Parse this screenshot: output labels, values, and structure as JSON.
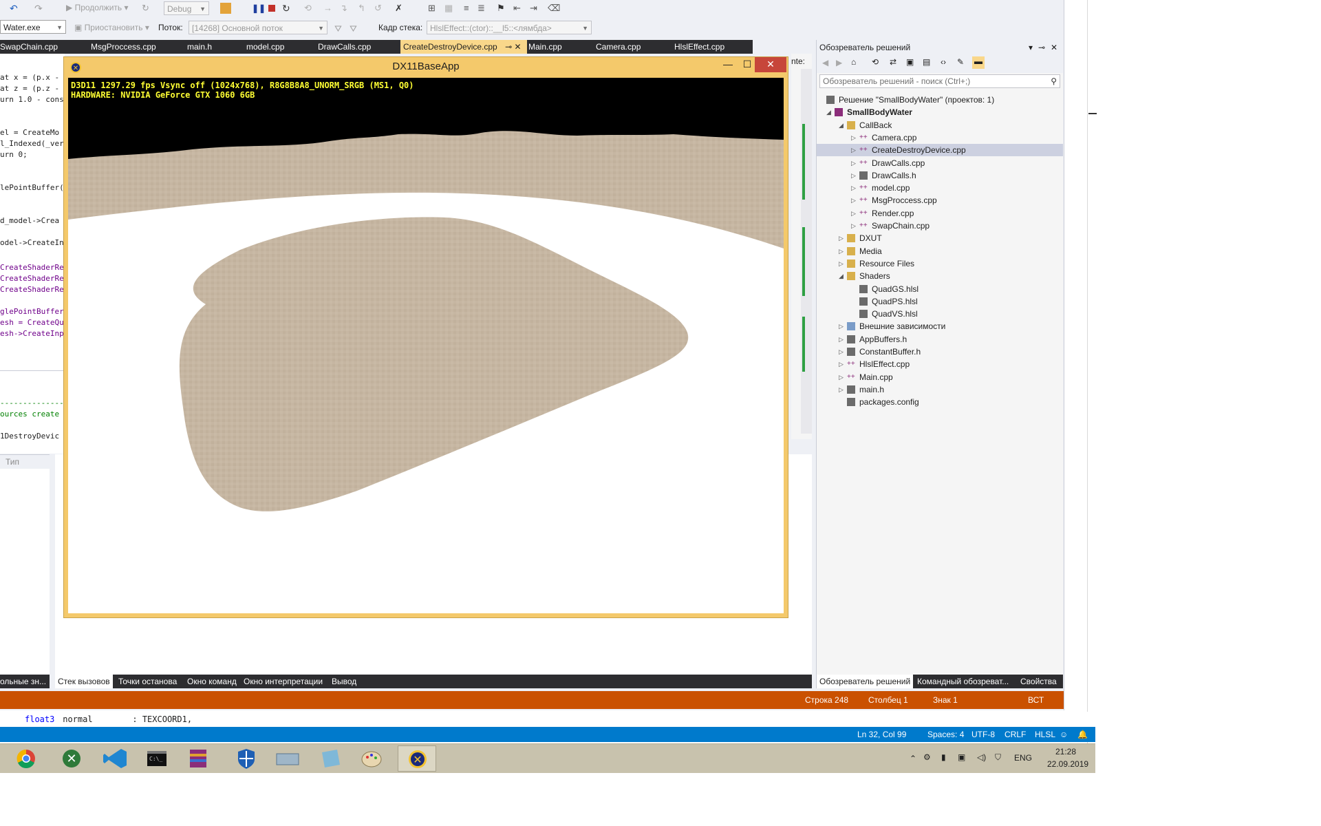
{
  "toolbar": {
    "continue_label": "Продолжить",
    "config_value": "Debug",
    "startup_value": "Water.exe",
    "pause_label": "Приостановить",
    "thread_label": "Поток:",
    "thread_value": "[14268] Основной поток",
    "stackframe_label": "Кадр стека:",
    "stackframe_value": "HlslEffect::(ctor)::__l5::<лямбда>"
  },
  "tabs": [
    {
      "label": "SwapChain.cpp"
    },
    {
      "label": "MsgProccess.cpp"
    },
    {
      "label": "main.h"
    },
    {
      "label": "model.cpp"
    },
    {
      "label": "DrawCalls.cpp"
    },
    {
      "label": "CreateDestroyDevice.cpp",
      "active": true
    },
    {
      "label": "Main.cpp"
    },
    {
      "label": "Camera.cpp"
    },
    {
      "label": "HlslEffect.cpp"
    }
  ],
  "editor": {
    "lines": [
      "at x = (p.x -",
      "at z = (p.z -",
      "urn 1.0 - cons",
      "",
      "el = CreateMo",
      "l_Indexed(_ver",
      "urn 0;",
      "",
      "",
      "lePointBuffer(C",
      "",
      "",
      "d_model->Crea",
      "",
      "odel->CreateIn",
      "",
      "",
      "CreateShaderRe",
      "CreateShaderRe",
      "CreateShaderRe",
      "",
      "glePointBuffer",
      "esh = CreateQu",
      "esh->CreateInp"
    ],
    "lower_lines": [
      "----------------",
      "ources create",
      "",
      "1DestroyDevic"
    ],
    "side_label": "nte:"
  },
  "app": {
    "title": "DX11BaseApp",
    "minimize": "—",
    "maximize": "☐",
    "close": "✕",
    "hud_line1": "D3D11 1297.29 fps Vsync off (1024x768), R8G8B8A8_UNORM_SRGB (MS1, Q0)",
    "hud_line2": "HARDWARE: NVIDIA GeForce GTX 1060 6GB"
  },
  "solution": {
    "title": "Обозреватель решений",
    "search_placeholder": "Обозреватель решений - поиск (Ctrl+;)",
    "items": [
      {
        "label": "Решение \"SmallBodyWater\" (проектов: 1)",
        "level": 0,
        "arrow": "",
        "icon": "solution-icon"
      },
      {
        "label": "SmallBodyWater",
        "level": 1,
        "arrow": "◢",
        "bold": true,
        "icon": "project-icon"
      },
      {
        "label": "CallBack",
        "level": 2,
        "arrow": "◢",
        "icon": "folder-icon"
      },
      {
        "label": "Camera.cpp",
        "level": 3,
        "arrow": "▷",
        "icon": "cpp-file-icon"
      },
      {
        "label": "CreateDestroyDevice.cpp",
        "level": 3,
        "arrow": "▷",
        "icon": "cpp-file-icon",
        "selected": true
      },
      {
        "label": "DrawCalls.cpp",
        "level": 3,
        "arrow": "▷",
        "icon": "cpp-file-icon"
      },
      {
        "label": "DrawCalls.h",
        "level": 3,
        "arrow": "▷",
        "icon": "header-file-icon"
      },
      {
        "label": "model.cpp",
        "level": 3,
        "arrow": "▷",
        "icon": "cpp-file-icon"
      },
      {
        "label": "MsgProccess.cpp",
        "level": 3,
        "arrow": "▷",
        "icon": "cpp-file-icon"
      },
      {
        "label": "Render.cpp",
        "level": 3,
        "arrow": "▷",
        "icon": "cpp-file-icon"
      },
      {
        "label": "SwapChain.cpp",
        "level": 3,
        "arrow": "▷",
        "icon": "cpp-file-icon"
      },
      {
        "label": "DXUT",
        "level": 2,
        "arrow": "▷",
        "icon": "folder-icon"
      },
      {
        "label": "Media",
        "level": 2,
        "arrow": "▷",
        "icon": "folder-icon"
      },
      {
        "label": "Resource Files",
        "level": 2,
        "arrow": "▷",
        "icon": "folder-icon"
      },
      {
        "label": "Shaders",
        "level": 2,
        "arrow": "◢",
        "icon": "folder-icon"
      },
      {
        "label": "QuadGS.hlsl",
        "level": 3,
        "arrow": "",
        "icon": "hlsl-file-icon"
      },
      {
        "label": "QuadPS.hlsl",
        "level": 3,
        "arrow": "",
        "icon": "hlsl-file-icon"
      },
      {
        "label": "QuadVS.hlsl",
        "level": 3,
        "arrow": "",
        "icon": "hlsl-file-icon"
      },
      {
        "label": "Внешние зависимости",
        "level": 2,
        "arrow": "▷",
        "icon": "dependencies-icon"
      },
      {
        "label": "AppBuffers.h",
        "level": 2,
        "arrow": "▷",
        "icon": "header-file-icon"
      },
      {
        "label": "ConstantBuffer.h",
        "level": 2,
        "arrow": "▷",
        "icon": "header-file-icon"
      },
      {
        "label": "HlslEffect.cpp",
        "level": 2,
        "arrow": "▷",
        "icon": "cpp-file-icon"
      },
      {
        "label": "Main.cpp",
        "level": 2,
        "arrow": "▷",
        "icon": "cpp-file-icon"
      },
      {
        "label": "main.h",
        "level": 2,
        "arrow": "▷",
        "icon": "header-file-icon"
      },
      {
        "label": "packages.config",
        "level": 2,
        "arrow": "",
        "icon": "config-file-icon"
      }
    ],
    "bottom_tabs": [
      "Обозреватель решений",
      "Командный обозреват...",
      "Свойства"
    ]
  },
  "bottom_panel": {
    "left_header": "Тип",
    "left_tab": "ольные зн...",
    "tabs": [
      "Стек вызовов",
      "Точки останова",
      "Окно команд",
      "Окно интерпретации",
      "Вывод"
    ]
  },
  "status": {
    "line": "Строка 248",
    "column": "Столбец 1",
    "char": "Знак 1",
    "mode": "ВСТ"
  },
  "vscode": {
    "code_line_keyword": "float3",
    "code_line_rest": " normal        : TEXCOORD1,",
    "position": "Ln 32, Col 99",
    "spaces": "Spaces: 4",
    "encoding": "UTF-8",
    "eol": "CRLF",
    "language": "HLSL"
  },
  "taskbar": {
    "lang": "ENG",
    "time": "21:28",
    "date": "22.09.2019"
  },
  "colors": {
    "vs_chrome": "#eef0f5",
    "tab_active": "#f9d78a",
    "status_orange": "#ca5100",
    "vscode_blue": "#007acc",
    "terrain": "#c4b4a0",
    "app_frame": "#f4c96b"
  }
}
